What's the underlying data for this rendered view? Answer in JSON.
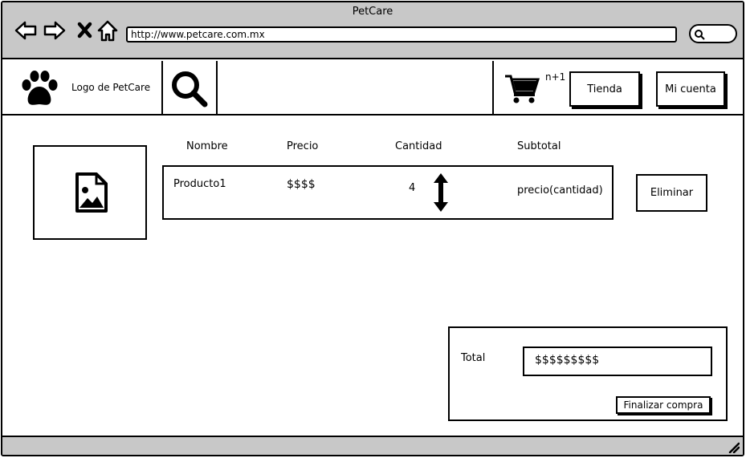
{
  "window": {
    "title": "PetCare"
  },
  "browser": {
    "url": "http://www.petcare.com.mx",
    "nav_icons": [
      "back-arrow-icon",
      "forward-arrow-icon",
      "close-x-icon",
      "home-icon"
    ]
  },
  "header": {
    "logo_text": "Logo de PetCare",
    "cart_badge": "n+1",
    "buttons": {
      "store": "Tienda",
      "account": "Mi cuenta"
    }
  },
  "cart": {
    "columns": [
      "Nombre",
      "Precio",
      "Cantidad",
      "Subtotal"
    ],
    "rows": [
      {
        "name": "Producto1",
        "price": "$$$$",
        "quantity": "4",
        "subtotal": "precio(cantidad)"
      }
    ],
    "delete_label": "Eliminar"
  },
  "totals": {
    "label": "Total",
    "value": "$$$$$$$$$",
    "checkout_label": "Finalizar compra"
  }
}
